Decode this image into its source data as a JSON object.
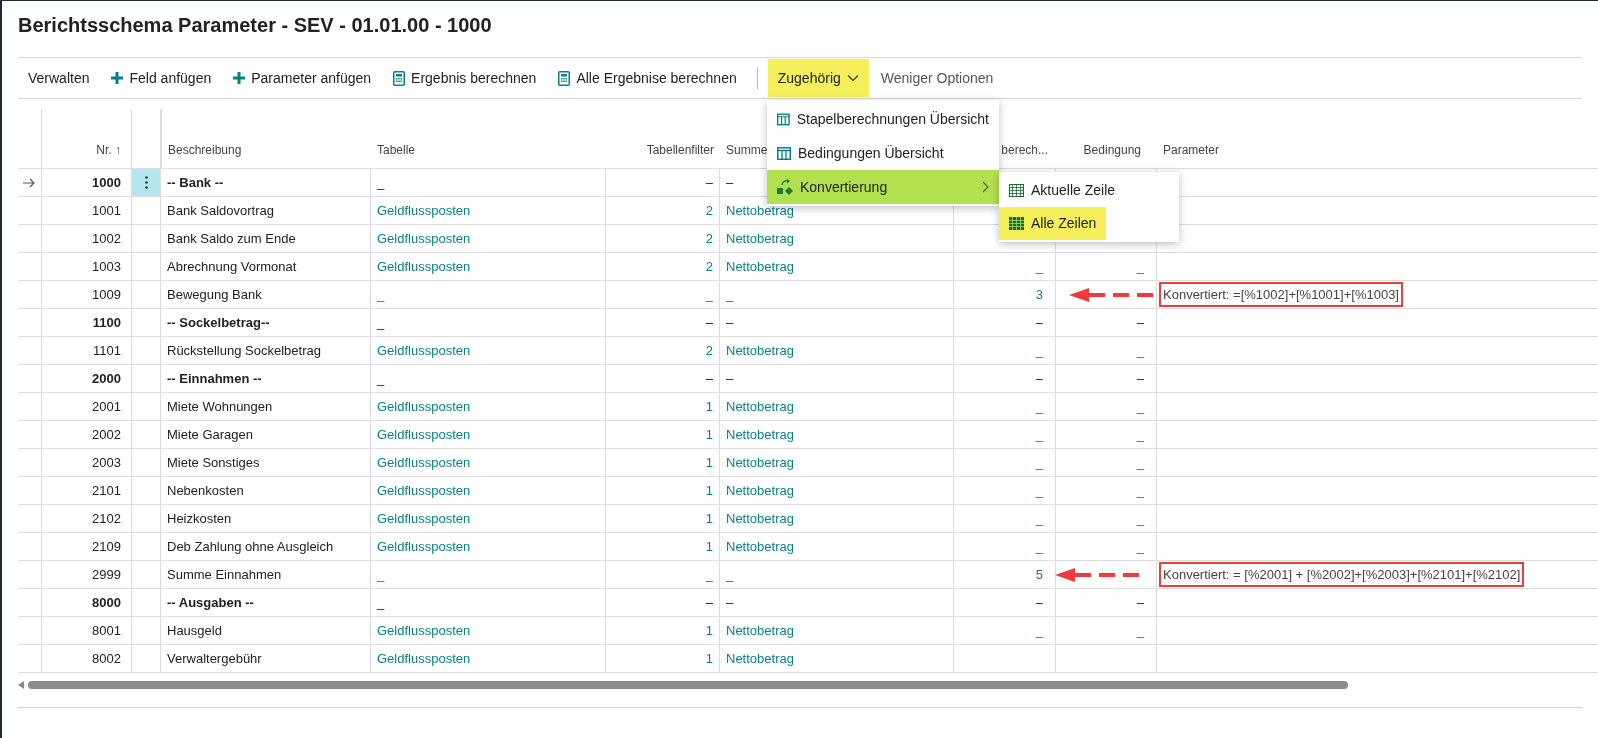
{
  "title": "Berichtsschema Parameter - SEV - 01.01.00 - 1000",
  "toolbar": [
    {
      "label": "Verwalten",
      "kind": "text",
      "highlighted": false
    },
    {
      "label": "Feld anfügen",
      "kind": "add",
      "highlighted": false
    },
    {
      "label": "Parameter anfügen",
      "kind": "add",
      "highlighted": false
    },
    {
      "label": "Ergebnis berechnen",
      "kind": "calc",
      "highlighted": false
    },
    {
      "label": "Alle Ergebnise berechnen",
      "kind": "calc",
      "highlighted": false
    },
    {
      "label": "Zugehörig",
      "kind": "dropdown",
      "highlighted": true
    },
    {
      "label": "Weniger Optionen",
      "kind": "muted",
      "highlighted": false
    }
  ],
  "menu": {
    "items": [
      {
        "label": "Stapelberechnungen Übersicht",
        "kind": "list",
        "highlighted": false
      },
      {
        "label": "Bedingungen Übersicht",
        "kind": "list",
        "highlighted": false
      },
      {
        "label": "Konvertierung",
        "kind": "convert",
        "highlighted": true
      }
    ],
    "submenu": [
      {
        "label": "Aktuelle Zeile",
        "highlighted": false
      },
      {
        "label": "Alle Zeilen",
        "highlighted": true
      }
    ]
  },
  "table": {
    "columns": [
      "Nr. ↑",
      "Beschreibung",
      "Tabelle",
      "Tabellenfilter",
      "Summe",
      "berech...",
      "Bedingung",
      "Parameter"
    ],
    "rows": [
      {
        "nr": "1000",
        "description": "-- Bank --",
        "kind": "group",
        "selected": true,
        "table_name": "_",
        "filter": "–",
        "sum_field": "–"
      },
      {
        "nr": "1001",
        "description": "Bank Saldovortrag",
        "kind": "line",
        "selected": false,
        "table_name": "Geldflussposten",
        "filter": "2",
        "sum_field": "Nettobetrag"
      },
      {
        "nr": "1002",
        "description": "Bank Saldo zum Ende",
        "kind": "line",
        "selected": false,
        "table_name": "Geldflussposten",
        "filter": "2",
        "sum_field": "Nettobetrag"
      },
      {
        "nr": "1003",
        "description": "Abrechnung Vormonat",
        "kind": "line",
        "selected": false,
        "table_name": "Geldflussposten",
        "filter": "2",
        "sum_field": "Nettobetrag",
        "calc": "_",
        "condition": "_"
      },
      {
        "nr": "1009",
        "description": "Bewegung Bank",
        "kind": "line",
        "selected": false,
        "table_name": "_",
        "filter": "_",
        "sum_field": "_",
        "calc": "3",
        "parameter": {
          "text": "Konvertiert: =[%1002]+[%1001]+[%1003]",
          "annotated": true
        }
      },
      {
        "nr": "1100",
        "description": "-- Sockelbetrag--",
        "kind": "group",
        "selected": false,
        "table_name": "_",
        "filter": "–",
        "sum_field": "–",
        "calc": "–",
        "condition": "–"
      },
      {
        "nr": "1101",
        "description": "Rückstellung Sockelbetrag",
        "kind": "line",
        "selected": false,
        "table_name": "Geldflussposten",
        "filter": "2",
        "sum_field": "Nettobetrag",
        "calc": "_",
        "condition": "_"
      },
      {
        "nr": "2000",
        "description": "-- Einnahmen --",
        "kind": "group",
        "selected": false,
        "table_name": "_",
        "filter": "–",
        "sum_field": "–",
        "calc": "–",
        "condition": "–"
      },
      {
        "nr": "2001",
        "description": "Miete Wohnungen",
        "kind": "line",
        "selected": false,
        "table_name": "Geldflussposten",
        "filter": "1",
        "sum_field": "Nettobetrag",
        "calc": "_",
        "condition": "_"
      },
      {
        "nr": "2002",
        "description": "Miete Garagen",
        "kind": "line",
        "selected": false,
        "table_name": "Geldflussposten",
        "filter": "1",
        "sum_field": "Nettobetrag",
        "calc": "_",
        "condition": "_"
      },
      {
        "nr": "2003",
        "description": "Miete Sonstiges",
        "kind": "line",
        "selected": false,
        "table_name": "Geldflussposten",
        "filter": "1",
        "sum_field": "Nettobetrag",
        "calc": "_",
        "condition": "_"
      },
      {
        "nr": "2101",
        "description": "Nebenkosten",
        "kind": "line",
        "selected": false,
        "table_name": "Geldflussposten",
        "filter": "1",
        "sum_field": "Nettobetrag",
        "calc": "_",
        "condition": "_"
      },
      {
        "nr": "2102",
        "description": "Heizkosten",
        "kind": "line",
        "selected": false,
        "table_name": "Geldflussposten",
        "filter": "1",
        "sum_field": "Nettobetrag",
        "calc": "_",
        "condition": "_"
      },
      {
        "nr": "2109",
        "description": "Deb Zahlung ohne Ausgleich",
        "kind": "line",
        "selected": false,
        "table_name": "Geldflussposten",
        "filter": "1",
        "sum_field": "Nettobetrag",
        "calc": "_",
        "condition": "_"
      },
      {
        "nr": "2999",
        "description": "Summe Einnahmen",
        "kind": "total",
        "selected": false,
        "table_name": "_",
        "filter": "_",
        "sum_field": "_",
        "calc": "5",
        "parameter": {
          "text": "Konvertiert: = [%2001] + [%2002]+[%2003]+[%2101]+[%2102]",
          "annotated": true
        }
      },
      {
        "nr": "8000",
        "description": "-- Ausgaben --",
        "kind": "group",
        "selected": false,
        "table_name": "_",
        "filter": "–",
        "sum_field": "–",
        "calc": "–",
        "condition": "–"
      },
      {
        "nr": "8001",
        "description": "Hausgeld",
        "kind": "line",
        "selected": false,
        "table_name": "Geldflussposten",
        "filter": "1",
        "sum_field": "Nettobetrag",
        "calc": "_",
        "condition": "_"
      },
      {
        "nr": "8002",
        "description": "Verwaltergebühr",
        "kind": "line",
        "selected": false,
        "table_name": "Geldflussposten",
        "filter": "1",
        "sum_field": "Nettobetrag"
      }
    ]
  }
}
